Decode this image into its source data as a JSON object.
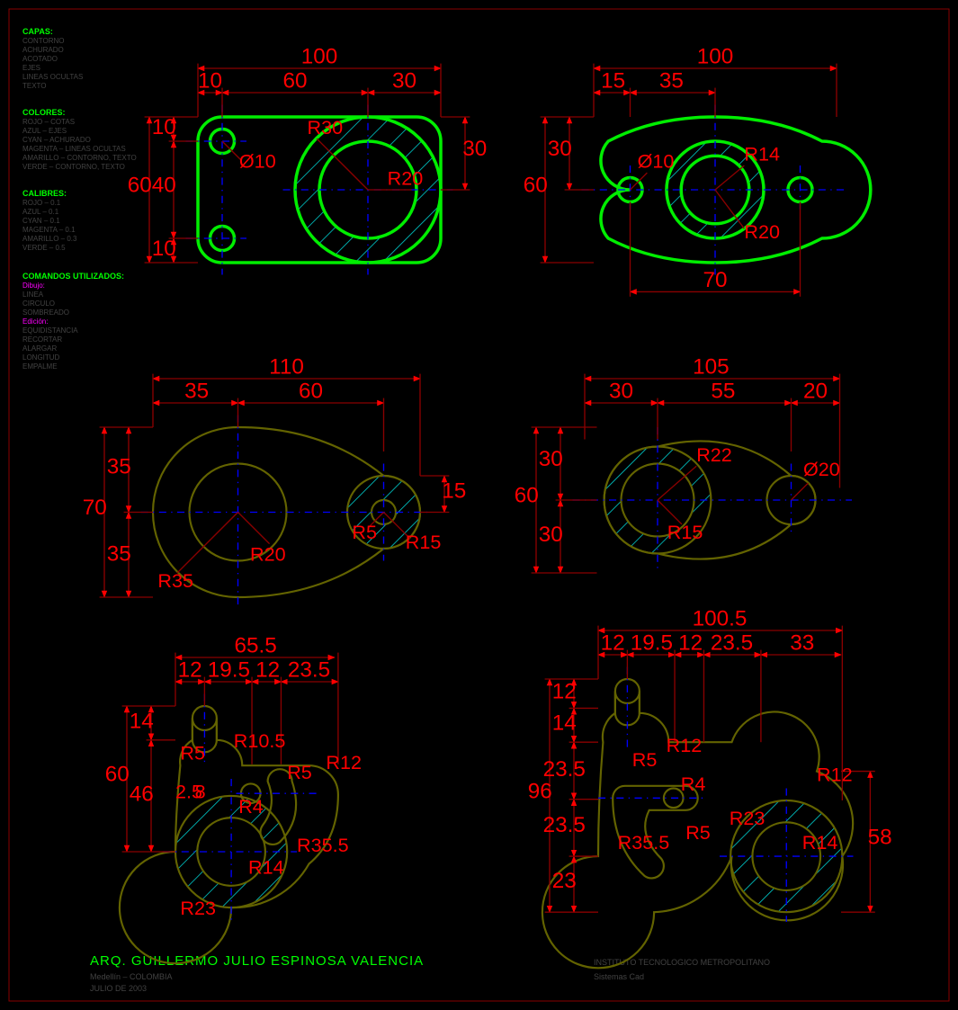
{
  "legend": {
    "capas": {
      "head": "CAPAS:",
      "items": [
        "CONTORNO",
        "ACHURADO",
        "ACOTADO",
        "EJES",
        "LINEAS OCULTAS",
        "TEXTO"
      ]
    },
    "colores": {
      "head": "COLORES:",
      "items": [
        "ROJO – COTAS",
        "AZUL – EJES",
        "CYAN – ACHURADO",
        "MAGENTA – LINEAS OCULTAS",
        "AMARILLO – CONTORNO, TEXTO",
        "VERDE – CONTORNO, TEXTO"
      ]
    },
    "calibres": {
      "head": "CALIBRES:",
      "items": [
        "ROJO – 0.1",
        "AZUL – 0.1",
        "CYAN – 0.1",
        "MAGENTA – 0.1",
        "AMARILLO – 0.3",
        "VERDE – 0.5"
      ]
    },
    "comandos": {
      "head": "COMANDOS UTILIZADOS:",
      "dibujo": "Dibujo:",
      "ditems": [
        "LINEA",
        "CIRCULO",
        "SOMBREADO"
      ],
      "edicion": "Edición:",
      "eitems": [
        "EQUIDISTANCIA",
        "RECORTAR",
        "ALARGAR",
        "LONGITUD",
        "EMPALME"
      ]
    }
  },
  "footer": {
    "title": "ARQ. GUILLERMO JULIO ESPINOSA VALENCIA",
    "loc": "Medellín – COLOMBIA",
    "date": "JULIO DE 2003",
    "inst_a": "INSTITUTO TECNOLOGICO METROPOLITANO",
    "inst_b": "Sistemas Cad"
  },
  "p1": {
    "dt": {
      "w": "100",
      "a": "10",
      "b": "60",
      "c": "30"
    },
    "dl": {
      "h": "60",
      "a": "10",
      "b": "40",
      "c": "10"
    },
    "dr": "30",
    "lbl": {
      "r30": "R30",
      "r20": "R20",
      "d10": "Ø10"
    }
  },
  "p2": {
    "dt": {
      "w": "100",
      "a": "15",
      "b": "35"
    },
    "dl": {
      "h": "60",
      "a": "30"
    },
    "db": "70",
    "lbl": {
      "r20": "R20",
      "r14": "R14",
      "d10": "Ø10"
    }
  },
  "p3": {
    "dt": {
      "w": "110",
      "a": "35",
      "b": "60"
    },
    "dl": {
      "h": "70",
      "a": "35",
      "b": "35"
    },
    "dr": "15",
    "lbl": {
      "r35": "R35",
      "r20": "R20",
      "r15": "R15",
      "r5": "R5"
    }
  },
  "p4": {
    "dt": {
      "w": "105",
      "a": "30",
      "b": "55",
      "c": "20"
    },
    "dl": {
      "h": "60",
      "a": "30",
      "b": "30"
    },
    "lbl": {
      "r22": "R22",
      "r15": "R15",
      "d20": "Ø20"
    }
  },
  "p5": {
    "dt": {
      "w": "65.5",
      "a": "12",
      "b": "19.5",
      "c": "12",
      "d": "23.5"
    },
    "dl": {
      "h": "60",
      "a": "14",
      "b": "46"
    },
    "lbl": {
      "r23": "R23",
      "r14": "R14",
      "r10_5": "R10.5",
      "r5": "R5",
      "r5b": "R5",
      "r12": "R12",
      "r4": "R4",
      "r35_5": "R35.5"
    },
    "extra": {
      "a": "2.5",
      "b": "8"
    }
  },
  "p6": {
    "dt": {
      "w": "100.5",
      "a": "12",
      "b": "19.5",
      "c": "12",
      "d": "23.5",
      "e": "33"
    },
    "dl": {
      "h": "96",
      "a": "12",
      "b": "14",
      "c": "23.5",
      "d": "23.5",
      "e": "23"
    },
    "dr": "58",
    "lbl": {
      "r23": "R23",
      "r14": "R14",
      "r12": "R12",
      "r12b": "R12",
      "r5": "R5",
      "r5b": "R5",
      "r4": "R4",
      "r35_5": "R35.5"
    }
  }
}
